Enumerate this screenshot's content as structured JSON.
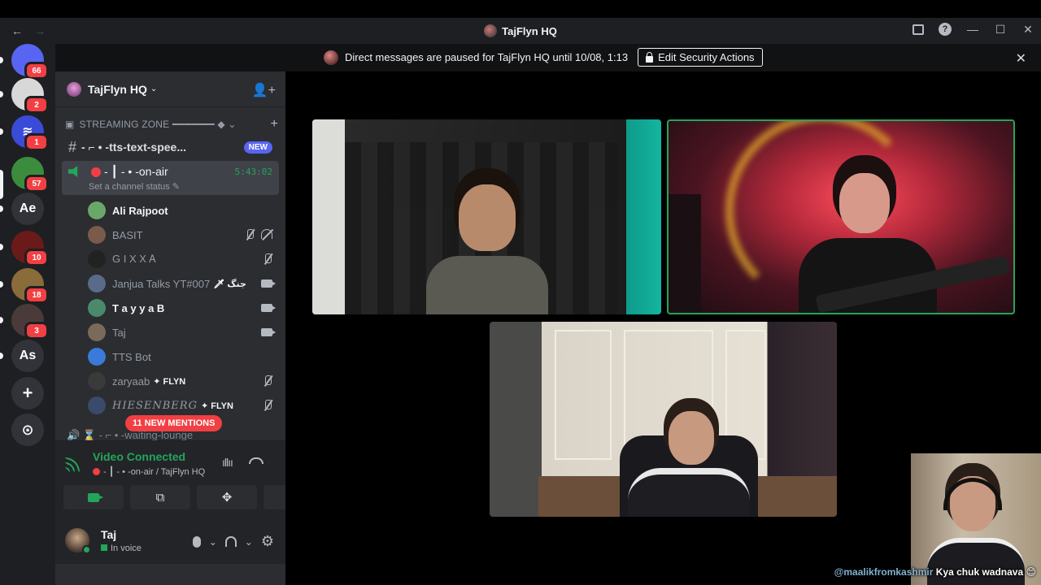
{
  "window": {
    "title": "TajFlyn HQ",
    "back_glyph": "←",
    "forward_glyph": "→"
  },
  "notice": {
    "text": "Direct messages are paused for TajFlyn HQ until 10/08, 1:13",
    "button_label": "Edit Security Actions",
    "close_glyph": "✕"
  },
  "rail": {
    "servers": [
      {
        "name": "discord-home",
        "badge": "66",
        "color": "#5865f2",
        "glyph": ""
      },
      {
        "name": "server-2",
        "badge": "2",
        "color": "#d8d8d8",
        "glyph": ""
      },
      {
        "name": "server-3",
        "badge": "1",
        "color": "#3a4bd8",
        "glyph": "≋"
      },
      {
        "name": "server-4",
        "badge": "57",
        "color": "#3b8d3d",
        "glyph": ""
      },
      {
        "name": "server-ae",
        "badge": "",
        "color": "#313338",
        "glyph": "Ae"
      },
      {
        "name": "server-6",
        "badge": "10",
        "color": "#6b1a1a",
        "glyph": ""
      },
      {
        "name": "server-7",
        "badge": "18",
        "color": "#8a6b3a",
        "glyph": ""
      },
      {
        "name": "server-8",
        "badge": "3",
        "color": "#4b3a3a",
        "glyph": ""
      },
      {
        "name": "server-as",
        "badge": "",
        "color": "#313338",
        "glyph": "As"
      }
    ],
    "add_glyph": "+",
    "discover_glyph": "⊙"
  },
  "sidebar": {
    "guild_name": "TajFlyn HQ",
    "category": "STREAMING ZONE ━━━━━━━ ◆ ⌄",
    "text_channel": "- ⌐ • -tts-text-spee...",
    "new_badge": "NEW",
    "voice_channel": {
      "name": "- ┃ - • -on-air",
      "timer": "5:43:02",
      "status": "Set a channel status ✎"
    },
    "members": [
      {
        "name": "Ali Rajpoot",
        "active": true,
        "tag": "",
        "icons": [],
        "color": "#6aa86a"
      },
      {
        "name": "BASIT",
        "active": false,
        "tag": "",
        "icons": [
          "muted",
          "deaf"
        ],
        "color": "#7a5a4a"
      },
      {
        "name": "G I X X Ꭺ",
        "active": false,
        "tag": "",
        "icons": [
          "muted"
        ],
        "color": "#222"
      },
      {
        "name": "Janjua Talks YT#007",
        "active": false,
        "tag": "🗡 جنگ",
        "icons": [
          "cam"
        ],
        "color": "#5a6a8a"
      },
      {
        "name": "T a y y a B",
        "active": true,
        "tag": "",
        "icons": [
          "cam"
        ],
        "color": "#4a8a6a"
      },
      {
        "name": "Taj",
        "active": false,
        "tag": "",
        "icons": [
          "cam"
        ],
        "color": "#7a6a5a"
      },
      {
        "name": "TTS Bot",
        "active": false,
        "tag": "",
        "icons": [],
        "color": "#3a7ad8"
      },
      {
        "name": "zaryaab",
        "active": false,
        "tag": "✦ FLYN",
        "icons": [
          "muted"
        ],
        "color": "#3a3a3a"
      },
      {
        "name": "HIESENBERG",
        "active": false,
        "tag": "✦ FLYN",
        "icons": [
          "muted"
        ],
        "color": "#3a4a6a"
      }
    ],
    "mentions": "11 NEW MENTIONS",
    "waiting_channel": "🔊  ⌛ -  ⌐ • -waiting-lounge"
  },
  "voice_panel": {
    "title": "Video Connected",
    "subtitle": "- ┃ - • -on-air / TajFlyn HQ"
  },
  "user_panel": {
    "name": "Taj",
    "status": "In voice"
  },
  "overlay": {
    "handle": "@maalikfromkashmir",
    "message": "Kya chuk wadnava 😊"
  }
}
